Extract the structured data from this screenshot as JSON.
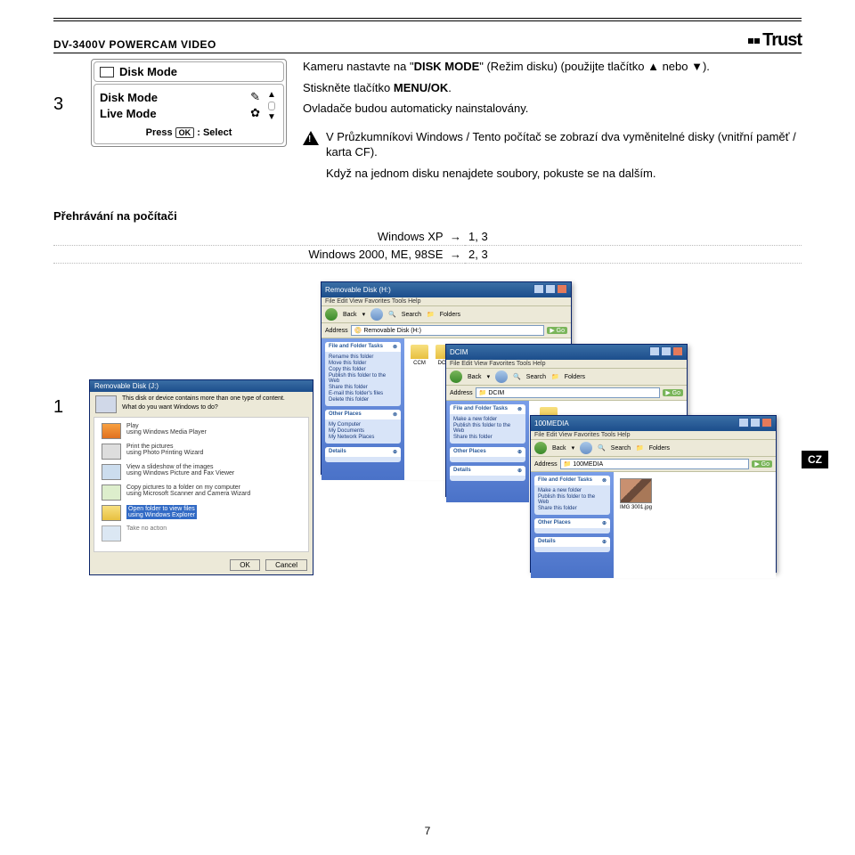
{
  "header": {
    "product": "DV-3400V POWERCAM VIDEO",
    "brand": "Trust"
  },
  "diskmode": {
    "title": "Disk Mode",
    "options": [
      "Disk Mode",
      "Live Mode"
    ],
    "press": "Press",
    "select": ": Select"
  },
  "step3": {
    "num": "3",
    "line1a": "Kameru nastavte na \"",
    "line1b": "DISK MODE",
    "line1c": "\" (Režim disku) (použijte tlačítko ▲ nebo ▼).",
    "line2a": "Stiskněte tlačítko ",
    "line2b": "MENU/OK",
    "line2c": ".",
    "line3": "Ovladače budou automaticky nainstalovány.",
    "warn1": "V Průzkumníkovi Windows / Tento počítač se zobrazí dva vyměnitelné disky (vnitřní paměť / karta CF).",
    "warn2": "Když na jednom disku nenajdete soubory, pokuste se na dalším."
  },
  "playback": {
    "title": "Přehrávání na počítači",
    "rows": [
      {
        "os": "Windows XP",
        "steps": "1, 3"
      },
      {
        "os": "Windows 2000, ME, 98SE",
        "steps": "2, 3"
      }
    ],
    "arrow": "→"
  },
  "figure": {
    "num": "1",
    "lang": "CZ"
  },
  "windows": {
    "menubar": "File   Edit   View   Favorites   Tools   Help",
    "back": "Back",
    "search": "Search",
    "folders": "Folders",
    "address": "Address",
    "go": "Go",
    "tasks_title": "File and Folder Tasks",
    "other_title": "Other Places",
    "details_title": "Details",
    "win1": {
      "title": "Removable Disk (H:)",
      "addr": "Removable Disk (H:)",
      "tasks": [
        "Rename this folder",
        "Move this folder",
        "Copy this folder",
        "Publish this folder to the Web",
        "Share this folder",
        "E-mail this folder's files",
        "Delete this folder"
      ],
      "other": [
        "My Computer",
        "My Documents",
        "My Network Places"
      ],
      "content": [
        "CCM",
        "DCIM"
      ]
    },
    "win2": {
      "title": "DCIM",
      "addr": "DCIM",
      "tasks": [
        "Make a new folder",
        "Publish this folder to the Web",
        "Share this folder"
      ],
      "content": [
        "100MEDIA"
      ]
    },
    "win3": {
      "title": "100MEDIA",
      "addr": "100MEDIA",
      "tasks": [
        "Make a new folder",
        "Publish this folder to the Web",
        "Share this folder"
      ],
      "thumb": "IMG 3001.jpg"
    }
  },
  "dialog": {
    "title": "Removable Disk (J:)",
    "intro1": "This disk or device contains more than one type of content.",
    "intro2": "What do you want Windows to do?",
    "opts": [
      "Play\nusing Windows Media Player",
      "Print the pictures\nusing Photo Printing Wizard",
      "View a slideshow of the images\nusing Windows Picture and Fax Viewer",
      "Copy pictures to a folder on my computer\nusing Microsoft Scanner and Camera Wizard"
    ],
    "selected": "Open folder to view files\nusing Windows Explorer",
    "last": "Take no action",
    "ok": "OK",
    "cancel": "Cancel"
  },
  "page_num": "7"
}
